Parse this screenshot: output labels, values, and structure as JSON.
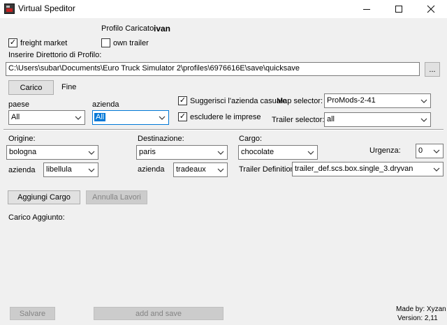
{
  "window": {
    "title": "Virtual Speditor",
    "minimize": "—",
    "maximize": "☐",
    "close": "✕"
  },
  "profile": {
    "label": "Profilo Caricato:",
    "value": "ivan"
  },
  "checkboxes": {
    "freight_market": {
      "label": "freight market",
      "checked": true,
      "mark": "✓"
    },
    "own_trailer": {
      "label": "own trailer",
      "checked": false,
      "mark": ""
    },
    "suggest_company": {
      "label": "Suggerisci l'azienda casuale",
      "checked": true,
      "mark": "✓"
    },
    "exclude_companies": {
      "label": "escludere le imprese",
      "checked": true,
      "mark": "✓"
    }
  },
  "directory": {
    "label": "Inserire Direttorio di Profilo:",
    "value": "C:\\Users\\subar\\Documents\\Euro Truck Simulator 2\\profiles\\6976616E\\save\\quicksave",
    "browse_label": "..."
  },
  "load": {
    "button_label": "Carico",
    "status": "Fine"
  },
  "filters": {
    "paese_label": "paese",
    "paese_value": "All",
    "azienda_label": "azienda",
    "azienda_value": "All",
    "map_selector_label": "Map selector:",
    "map_selector_value": "ProMods-2-41",
    "trailer_selector_label": "Trailer selector:",
    "trailer_selector_value": "all"
  },
  "cargo_form": {
    "origin_label": "Origine:",
    "origin_value": "bologna",
    "origin_company_label": "azienda",
    "origin_company_value": "libellula",
    "destination_label": "Destinazione:",
    "destination_value": "paris",
    "destination_company_label": "azienda",
    "destination_company_value": "tradeaux",
    "cargo_label": "Cargo:",
    "cargo_value": "chocolate",
    "urgency_label": "Urgenza:",
    "urgency_value": "0",
    "trailer_def_label": "Trailer Definition",
    "trailer_def_value": "trailer_def.scs.box.single_3.dryvan"
  },
  "actions": {
    "add_cargo": "Aggiungi Cargo",
    "cancel_jobs": "Annulla Lavori",
    "added_cargo_label": "Carico Aggiunto:",
    "save": "Salvare",
    "add_and_save": "add and save"
  },
  "footer": {
    "made_by": "Made by: Xyzan",
    "version": "Version: 2,11"
  },
  "colors": {
    "accent": "#0078d7",
    "window_bg": "#f0f0f0"
  }
}
